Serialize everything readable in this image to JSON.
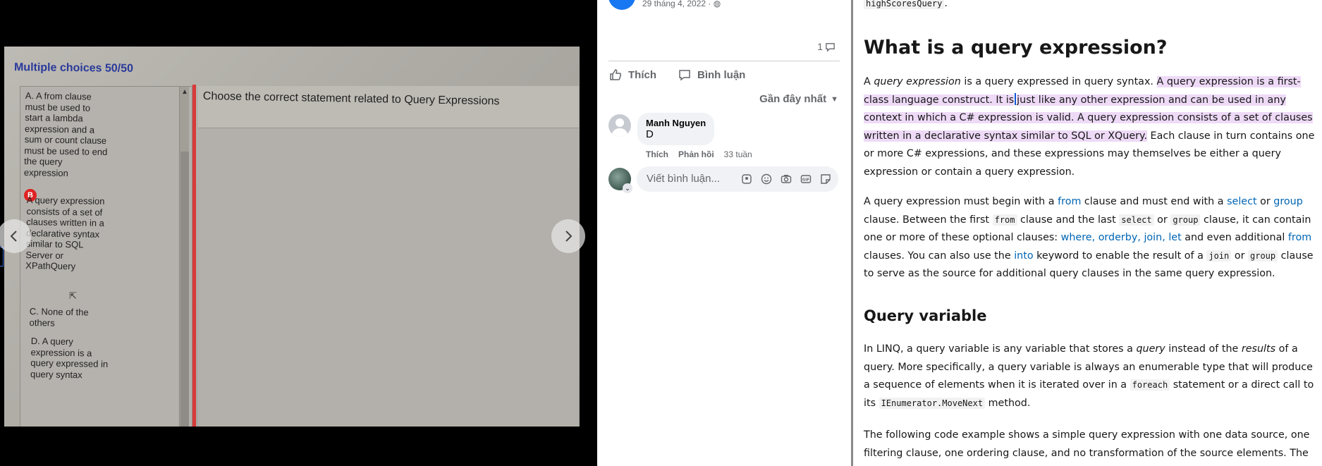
{
  "photo": {
    "heading": "Multiple choices 50/50",
    "question": "Choose the correct statement related to Query Expressions",
    "options": [
      {
        "label": "A. A from clause must be used to start a lambda expression and a sum or count clause must be used to end the query expression"
      },
      {
        "label": "A query expression consists of a set of clauses written in a declarative syntax similar to SQL Server or XPathQuery"
      },
      {
        "label": "C. None of the others"
      },
      {
        "label": "D. A query expression is a query expressed in query syntax"
      }
    ],
    "selected_marker": "B"
  },
  "facebook": {
    "post_date": "29 tháng 4, 2022 · ",
    "comment_count": "1",
    "like_label": "Thích",
    "comment_label": "Bình luận",
    "sort_label": "Gần đây nhất",
    "comment": {
      "author": "Manh Nguyen",
      "text": "D",
      "like": "Thích",
      "reply": "Phản hồi",
      "time": "33 tuần"
    },
    "input_placeholder": "Viết bình luận...",
    "brand_color": "#1877f2"
  },
  "docs": {
    "top_code": "highScoresQuery",
    "h1": "What is a query expression?",
    "p1": {
      "a": "A ",
      "em": "query expression",
      "b": " is a query expressed in query syntax. ",
      "hl1": "A query expression is a first-class language construct. It is",
      "hl2": "just like any other expression and can be used in any context in which a C# expression is valid. A query expression consists of a set of clauses written in a declarative syntax similar to SQL or XQuery.",
      "c": " Each clause in turn contains one or more C# expressions, and these expressions may themselves be either a query expression or contain a query expression."
    },
    "p2": {
      "t1": "A query expression must begin with a ",
      "from": "from",
      "t2": " clause and must end with a ",
      "select": "select",
      "t3": " or ",
      "group": "group",
      "t4": " clause. Between the first ",
      "code_from": "from",
      "t5": " clause and the last ",
      "code_select": "select",
      "t6": " or ",
      "code_group": "group",
      "t7": " clause, it can contain one or more of these optional clauses: ",
      "where": "where",
      "c1": ", ",
      "orderby": "orderby",
      "c2": ", ",
      "join": "join",
      "c3": ", ",
      "let": "let",
      "t8": " and even additional ",
      "from2": "from",
      "t9": " clauses. You can also use the ",
      "into": "into",
      "t10": " keyword to enable the result of a ",
      "code_join": "join",
      "t11": " or ",
      "code_group2": "group",
      "t12": " clause to serve as the source for additional query clauses in the same query expression."
    },
    "h2": "Query variable",
    "p3": {
      "t1": "In LINQ, a query variable is any variable that stores a ",
      "em1": "query",
      "t2": " instead of the ",
      "em2": "results",
      "t3": " of a query. More specifically, a query variable is always an enumerable type that will produce a sequence of elements when it is iterated over in a ",
      "code_foreach": "foreach",
      "t4": " statement or a direct call to its ",
      "code_movenext": "IEnumerator.MoveNext",
      "t5": " method."
    },
    "p4": "The following code example shows a simple query expression with one data source, one filtering clause, one ordering clause, and no transformation of the source elements. The",
    "highlight_color": "#eedaf7",
    "link_color": "#0065b3"
  }
}
